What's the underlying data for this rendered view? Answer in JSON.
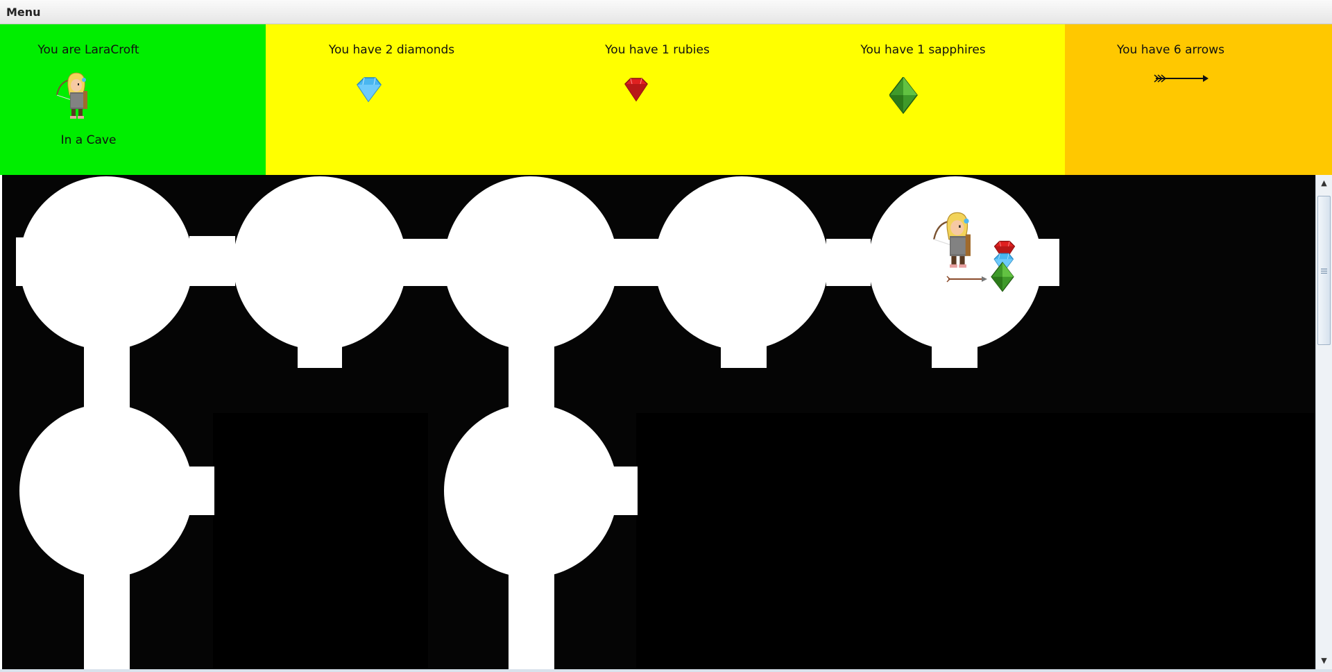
{
  "menu": {
    "label": "Menu"
  },
  "status": {
    "player": {
      "title": "You are LaraCroft",
      "location": "In a Cave",
      "avatar_icon": "archer-character-icon",
      "color": "#00ee00"
    },
    "diamonds": {
      "title": "You have 2 diamonds",
      "icon": "diamond-icon",
      "count": 2,
      "color": "#ffff00"
    },
    "rubies": {
      "title": "You have 1 rubies",
      "icon": "ruby-icon",
      "count": 1,
      "color": "#ffff00"
    },
    "sapphires": {
      "title": "You have 1 sapphires",
      "icon": "sapphire-icon",
      "count": 1,
      "color": "#ffff00"
    },
    "arrows": {
      "title": "You have 6 arrows",
      "icon": "arrow-icon",
      "count": 6,
      "color": "#ffc800"
    }
  },
  "map": {
    "background": "#000000",
    "room_color": "#ffffff",
    "player_room_items": [
      "archer-character-icon",
      "ruby-icon",
      "diamond-icon",
      "sapphire-icon",
      "arrow-icon"
    ]
  }
}
